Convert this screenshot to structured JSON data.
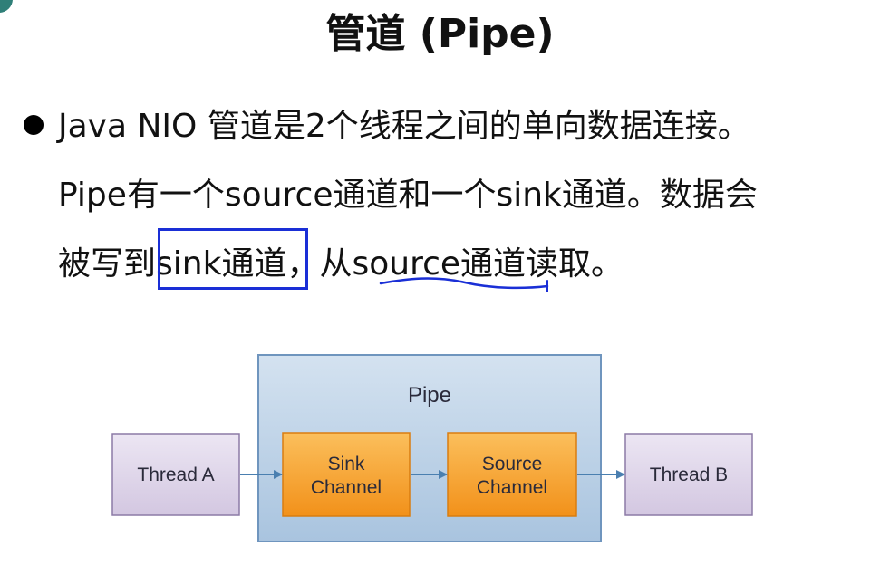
{
  "title": "管道 (Pipe)",
  "paragraph": {
    "line1": "Java NIO 管道是2个线程之间的单向数据连接。",
    "line2": "Pipe有一个source通道和一个sink通道。数据会",
    "line3_prefix": "被写到",
    "line3_boxed": "sink通道",
    "line3_mid": "，从",
    "line3_underlined": "source通道",
    "line3_suffix": "读取。"
  },
  "diagram": {
    "pipe_label": "Pipe",
    "thread_a": "Thread A",
    "sink_line1": "Sink",
    "sink_line2": "Channel",
    "source_line1": "Source",
    "source_line2": "Channel",
    "thread_b": "Thread B"
  },
  "colors": {
    "annotation": "#1a2fd6",
    "pipe_fill": "#c3d6ea",
    "pipe_border": "#6f95be",
    "thread_fill": "#e0d6ea",
    "thread_border": "#8c7aa6",
    "channel_fill": "#f7a231",
    "arrow": "#4a7fb0"
  }
}
